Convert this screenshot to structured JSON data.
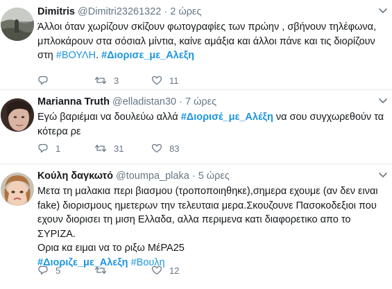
{
  "tweets": [
    {
      "name": "Dimitris",
      "handle": "@Dimitri23261322",
      "dot": "·",
      "time": "2 ώρες",
      "text_lines": [
        "Άλλοι όταν χωρίζουν σκίζουν φωτογραφίες των πρώην , σβήνουν τηλέφωνα,",
        "μπλοκάρουν στα σόσιαλ μίντια, καίνε αμάξια και άλλοι πάνε και τις διορίζουν",
        "στη "
      ],
      "hashtag_1": "#ΒΟΥΛΗ",
      "sep": ". ",
      "hashtag_2": "#Διορισε_με_Αλεξη",
      "replies": "",
      "retweets": "3",
      "likes": "11",
      "avatar_icon": "landscape-photo-avatar"
    },
    {
      "name": "Marianna Truth",
      "handle": "@elladistan30",
      "dot": "·",
      "time": "7 ώρες",
      "text_line_1_prefix": "Εγώ βαριέμαι να δουλεύω αλλά  ",
      "hashtag": "#Διορισέ_με_Αλέξη",
      "text_line_1_suffix": " να σου συγχωρεθούν τα",
      "text_line_2": "κότερα ρε",
      "replies": "1",
      "retweets": "31",
      "likes": "83",
      "avatar_icon": "woman-face-avatar"
    },
    {
      "name": "Κούλη δαγκωτό",
      "handle": "@toumpa_plaka",
      "dot": "·",
      "time": "5 ώρες",
      "text_lines": [
        "Μετα τη μαλακια περι βιασμου (τροποποιηθηκε),σημερα εχουμε (αν δεν ειναι",
        "fake) διορισμους ημετερων την τελευταια μερα.Σκουζουνε Πασοκοδεξιοι που",
        "εχουν διορισει τη μιση Ελλαδα, αλλα περιμενα κατι διαφορετικο απο το ΣΥΡΙΖΑ.",
        "Ορια κα ειμαι να το ριξω ΜέΡΑ25"
      ],
      "hashtag_1": "#Διοριζε_με_Αλεξη",
      "hashtag_2": "#Βουλη",
      "replies": "5",
      "retweets": "",
      "likes": "12",
      "avatar_icon": "child-face-avatar"
    }
  ],
  "colors": {
    "text": "#14171a",
    "muted": "#657786",
    "link": "#1b95e0",
    "border": "#e6ecf0"
  }
}
